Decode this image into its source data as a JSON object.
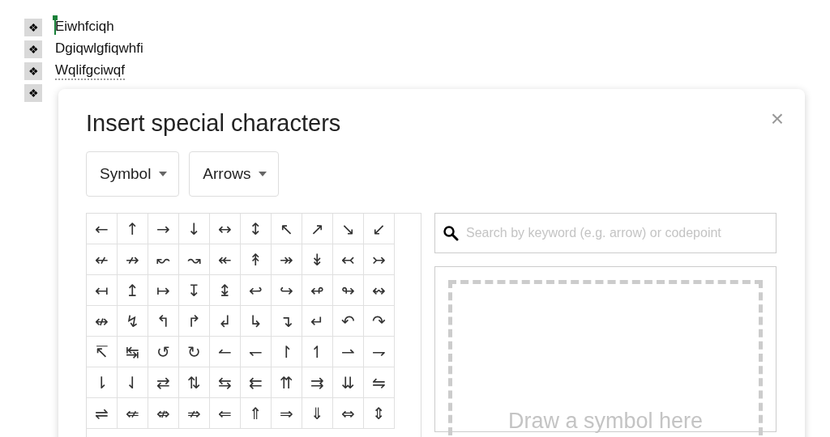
{
  "document": {
    "list": [
      {
        "bullet": "❖",
        "text": "Eiwhfciqh",
        "cursor": true,
        "misspelled": false
      },
      {
        "bullet": "❖",
        "text": "Dgiqwlgfiqwhfi",
        "cursor": false,
        "misspelled": false
      },
      {
        "bullet": "❖",
        "text": "Wqlifgciwqf",
        "cursor": false,
        "misspelled": true
      },
      {
        "bullet": "❖"
      }
    ]
  },
  "dialog": {
    "title": "Insert special characters",
    "close": "×",
    "dropdowns": [
      {
        "label": "Symbol"
      },
      {
        "label": "Arrows"
      }
    ],
    "grid": [
      [
        "←",
        "↑",
        "→",
        "↓",
        "↔",
        "↕",
        "↖",
        "↗",
        "↘",
        "↙"
      ],
      [
        "↚",
        "↛",
        "↜",
        "↝",
        "↞",
        "↟",
        "↠",
        "↡",
        "↢",
        "↣"
      ],
      [
        "↤",
        "↥",
        "↦",
        "↧",
        "↨",
        "↩",
        "↪",
        "↫",
        "↬",
        "↭"
      ],
      [
        "↮",
        "↯",
        "↰",
        "↱",
        "↲",
        "↳",
        "↴",
        "↵",
        "↶",
        "↷"
      ],
      [
        "↸",
        "↹",
        "↺",
        "↻",
        "↼",
        "↽",
        "↾",
        "↿",
        "⇀",
        "⇁"
      ],
      [
        "⇂",
        "⇃",
        "⇄",
        "⇅",
        "⇆",
        "⇇",
        "⇈",
        "⇉",
        "⇊",
        "⇋"
      ],
      [
        "⇌",
        "⇍",
        "⇎",
        "⇏",
        "⇐",
        "⇑",
        "⇒",
        "⇓",
        "⇔",
        "⇕"
      ]
    ],
    "search": {
      "placeholder": "Search by keyword (e.g. arrow) or codepoint"
    },
    "draw_area": {
      "hint": "Draw a symbol here"
    }
  }
}
